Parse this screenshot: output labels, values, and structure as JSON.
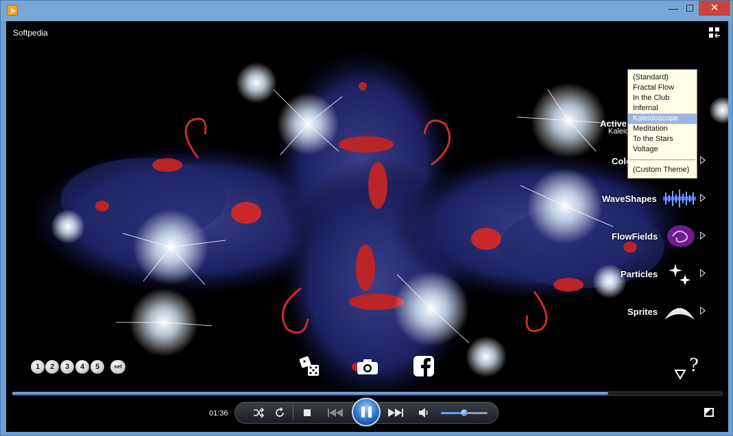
{
  "window": {
    "minimize_glyph": "—",
    "maximize_glyph": "☐",
    "close_glyph": "✕"
  },
  "stage": {
    "title": "Softpedia"
  },
  "menu": {
    "active_label": "Active",
    "active_sub": "Kaleid",
    "colors_label": "Colo",
    "waveshapes_label": "WaveShapes",
    "flowfields_label": "FlowFields",
    "particles_label": "Particles",
    "sprites_label": "Sprites"
  },
  "theme_dropdown": {
    "items": [
      "(Standard)",
      "Fractal Flow",
      "In the Club",
      "Infernal",
      "Kaleidoscope",
      "Meditation",
      "To the Stars",
      "Voltage"
    ],
    "selected": "Kaleidoscope",
    "custom": "(Custom Theme)"
  },
  "presets": {
    "buttons": [
      "1",
      "2",
      "3",
      "4",
      "5"
    ],
    "set_label": "set"
  },
  "bottom_icons": {
    "dice": "dice-icon",
    "camera": "camera-icon",
    "facebook": "facebook-icon",
    "help": "?"
  },
  "playback": {
    "elapsed": "01:36",
    "progress": 0.84,
    "volume": 0.5
  },
  "colors": {
    "accent": "#3a78c6",
    "selection": "#9bb5df",
    "tooltip_bg": "#ffffe6"
  }
}
